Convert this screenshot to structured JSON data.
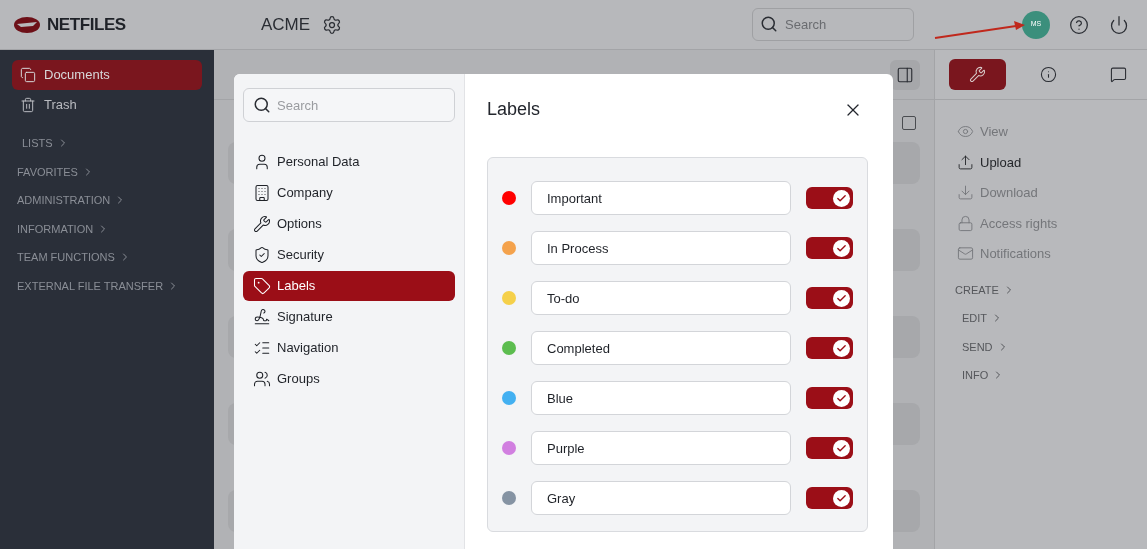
{
  "header": {
    "logo": "NETFILES",
    "workspace": "ACME",
    "search": {
      "placeholder": "Search"
    },
    "avatar": "MS"
  },
  "documents_list": {
    "select_all": {
      "checked": false
    }
  },
  "sidebar": {
    "items": [
      {
        "label": "Documents",
        "selected": true
      },
      {
        "label": "Trash",
        "selected": false
      }
    ],
    "sections": [
      "LISTS",
      "FAVORITES",
      "ADMINISTRATION",
      "INFORMATION",
      "TEAM FUNCTIONS",
      "EXTERNAL FILE TRANSFER"
    ]
  },
  "right_panel": {
    "tabs": [
      {
        "selected": true
      },
      {
        "selected": false
      },
      {
        "selected": false
      }
    ],
    "actions": [
      {
        "label": "View",
        "disabled": true
      },
      {
        "label": "Upload",
        "disabled": false
      },
      {
        "label": "Download",
        "disabled": true
      },
      {
        "label": "Access rights",
        "disabled": true
      },
      {
        "label": "Notifications",
        "disabled": true
      }
    ],
    "sections": [
      "CREATE",
      "EDIT",
      "SEND",
      "INFO"
    ]
  },
  "modal": {
    "search": {
      "placeholder": "Search"
    },
    "nav": [
      {
        "label": "Personal Data",
        "selected": false
      },
      {
        "label": "Company",
        "selected": false
      },
      {
        "label": "Options",
        "selected": false
      },
      {
        "label": "Security",
        "selected": false
      },
      {
        "label": "Labels",
        "selected": true
      },
      {
        "label": "Signature",
        "selected": false
      },
      {
        "label": "Navigation",
        "selected": false
      },
      {
        "label": "Groups",
        "selected": false
      }
    ],
    "title": "Labels",
    "labels": [
      {
        "name": "Important",
        "color": "#ff0000",
        "on": true
      },
      {
        "name": "In Process",
        "color": "#f4a24c",
        "on": true
      },
      {
        "name": "To-do",
        "color": "#f5d04a",
        "on": true
      },
      {
        "name": "Completed",
        "color": "#5cbd4f",
        "on": true
      },
      {
        "name": "Blue",
        "color": "#43b0f1",
        "on": true
      },
      {
        "name": "Purple",
        "color": "#d17fe0",
        "on": true
      },
      {
        "name": "Gray",
        "color": "#8593a3",
        "on": true
      }
    ]
  }
}
